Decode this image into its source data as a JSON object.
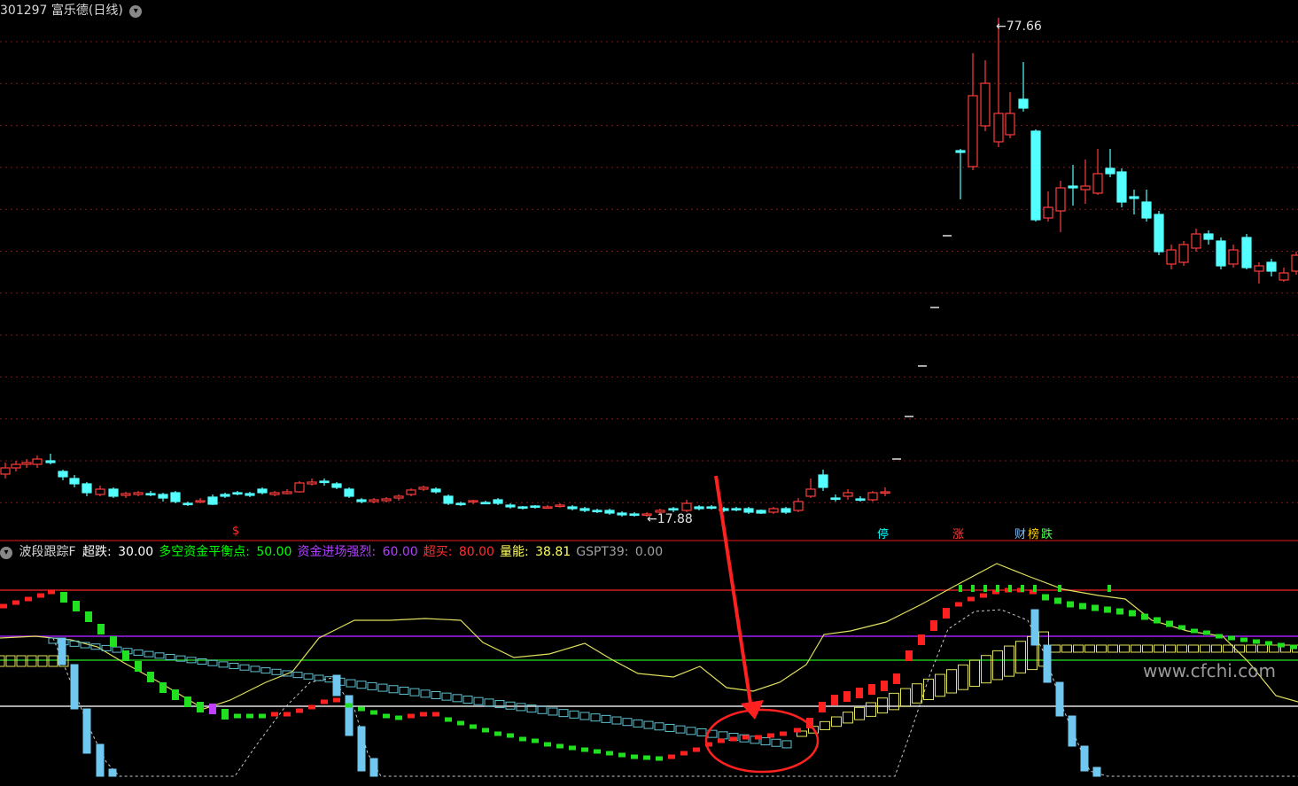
{
  "main_header": {
    "title": "301297 富乐德(日线)",
    "dropdown_icon": "chevron-down-icon"
  },
  "price_marks": {
    "high": "77.66",
    "low": "17.88"
  },
  "event_tags": [
    {
      "text": "$",
      "color": "#ff3030"
    },
    {
      "text": "停",
      "color": "#00ffff"
    },
    {
      "text": "涨",
      "color": "#ff4040"
    },
    {
      "text": "财",
      "color": "#80c0ff"
    },
    {
      "text": "榜",
      "color": "#ffd000"
    },
    {
      "text": "跌",
      "color": "#50ff50"
    }
  ],
  "indicator_header": {
    "name": "波段跟踪F",
    "dropdown_icon": "chevron-down-icon",
    "params": [
      {
        "label": "超跌",
        "value": "30.00",
        "label_color": "#ffffff",
        "value_color": "#ffffff"
      },
      {
        "label": "多空资金平衡点",
        "value": "50.00",
        "label_color": "#00ff00",
        "value_color": "#00ff00"
      },
      {
        "label": "资金进场强烈",
        "value": "60.00",
        "label_color": "#b040ff",
        "value_color": "#b040ff"
      },
      {
        "label": "超买",
        "value": "80.00",
        "label_color": "#ff3030",
        "value_color": "#ff3030"
      },
      {
        "label": "量能",
        "value": "38.81",
        "label_color": "#ffff60",
        "value_color": "#ffff60"
      },
      {
        "label": "GSPT39",
        "value": "0.00",
        "label_color": "#a0a0a0",
        "value_color": "#a0a0a0"
      }
    ]
  },
  "watermark": "www.cfchi.com",
  "colors": {
    "up": "#ff3c3c",
    "down": "#54ffff",
    "level_overbought": "#d02020",
    "level_strong": "#a020f0",
    "level_balance": "#20c020",
    "level_oversold": "#e0e0e0",
    "annotation": "#ff2020"
  }
}
